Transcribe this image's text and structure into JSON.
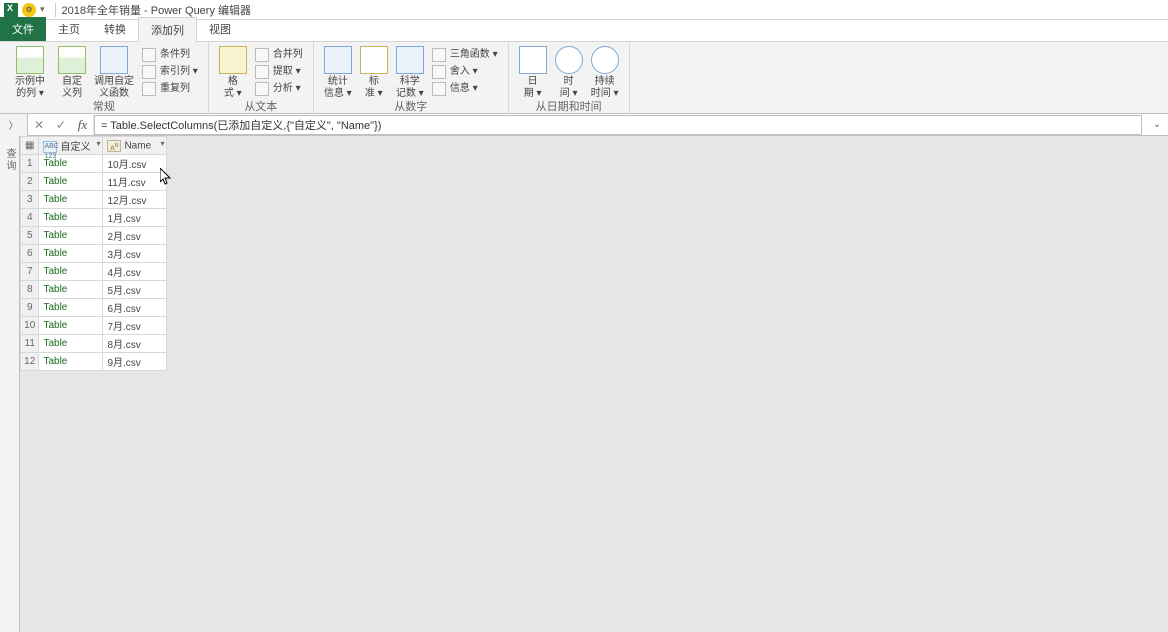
{
  "titlebar": {
    "title": "2018年全年销量 - Power Query 编辑器"
  },
  "tabs": {
    "file": "文件",
    "home": "主页",
    "transform": "转换",
    "addcolumn": "添加列",
    "view": "视图"
  },
  "ribbon": {
    "group_general": {
      "label": "常规",
      "examples": "示例中\n的列 ▾",
      "custom": "自定\n义列",
      "invokefn": "调用自定\n义函数",
      "cond": "条件列",
      "index": "索引列 ▾",
      "dup": "重复列"
    },
    "group_text": {
      "label": "从文本",
      "format": "格\n式 ▾",
      "merge": "合并列",
      "extract": "提取 ▾",
      "parse": "分析 ▾"
    },
    "group_number": {
      "label": "从数字",
      "stats": "统计\n信息 ▾",
      "standard": "标\n准 ▾",
      "scientific": "科学\n记数 ▾",
      "trig": "三角函数 ▾",
      "round": "舍入 ▾",
      "info": "信息 ▾"
    },
    "group_datetime": {
      "label": "从日期和时间",
      "date": "日\n期 ▾",
      "time": "时\n间 ▾",
      "duration": "持续\n时间 ▾"
    }
  },
  "formula": {
    "text": "= Table.SelectColumns(已添加自定义,{\"自定义\", \"Name\"})"
  },
  "sidebar": {
    "label": "查询"
  },
  "grid": {
    "columns": {
      "custom": "自定义",
      "name": "Name",
      "type_abc123": "ABC\n123"
    },
    "rows": [
      {
        "custom": "Table",
        "name": "10月.csv"
      },
      {
        "custom": "Table",
        "name": "11月.csv"
      },
      {
        "custom": "Table",
        "name": "12月.csv"
      },
      {
        "custom": "Table",
        "name": "1月.csv"
      },
      {
        "custom": "Table",
        "name": "2月.csv"
      },
      {
        "custom": "Table",
        "name": "3月.csv"
      },
      {
        "custom": "Table",
        "name": "4月.csv"
      },
      {
        "custom": "Table",
        "name": "5月.csv"
      },
      {
        "custom": "Table",
        "name": "6月.csv"
      },
      {
        "custom": "Table",
        "name": "7月.csv"
      },
      {
        "custom": "Table",
        "name": "8月.csv"
      },
      {
        "custom": "Table",
        "name": "9月.csv"
      }
    ]
  }
}
